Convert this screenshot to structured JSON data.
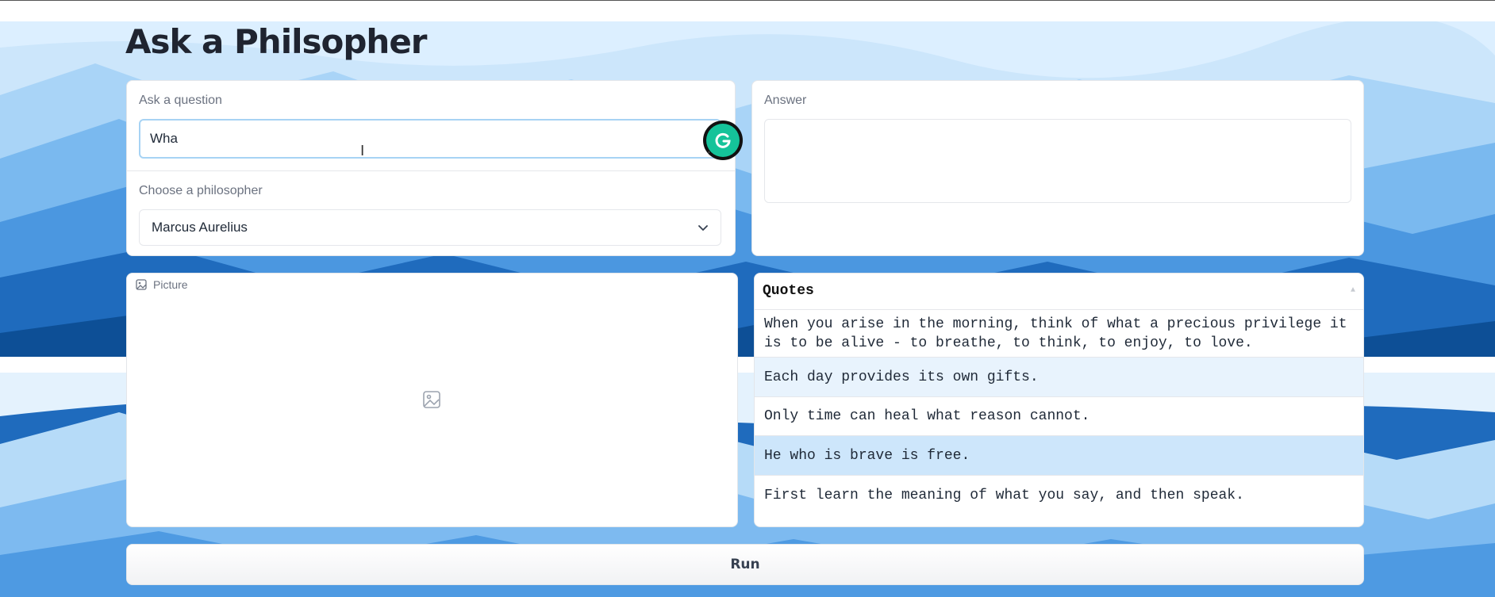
{
  "app": {
    "title": "Ask a Philsopher"
  },
  "question": {
    "label": "Ask a question",
    "value": "Wha"
  },
  "philosopher": {
    "label": "Choose a philosopher",
    "selected": "Marcus Aurelius"
  },
  "answer": {
    "label": "Answer",
    "value": ""
  },
  "picture": {
    "label": "Picture"
  },
  "quotes": {
    "header": "Quotes",
    "rows": [
      "When you arise in the morning, think of what a precious privilege it is to be alive - to breathe, to think, to enjoy, to love.",
      "Each day provides its own gifts.",
      "Only time can heal what reason cannot.",
      "He who is brave is free.",
      "First learn the meaning of what you say, and then speak."
    ]
  },
  "run": {
    "label": "Run"
  },
  "colors": {
    "accent": "#a7d3f4",
    "grammarly": "#15c39a",
    "highlight_row": "#e8f3fd",
    "selected_row": "#cde6fb"
  },
  "icons": [
    "grammarly-icon",
    "text-cursor-icon",
    "chevron-down-icon",
    "image-icon",
    "sort-icon"
  ]
}
